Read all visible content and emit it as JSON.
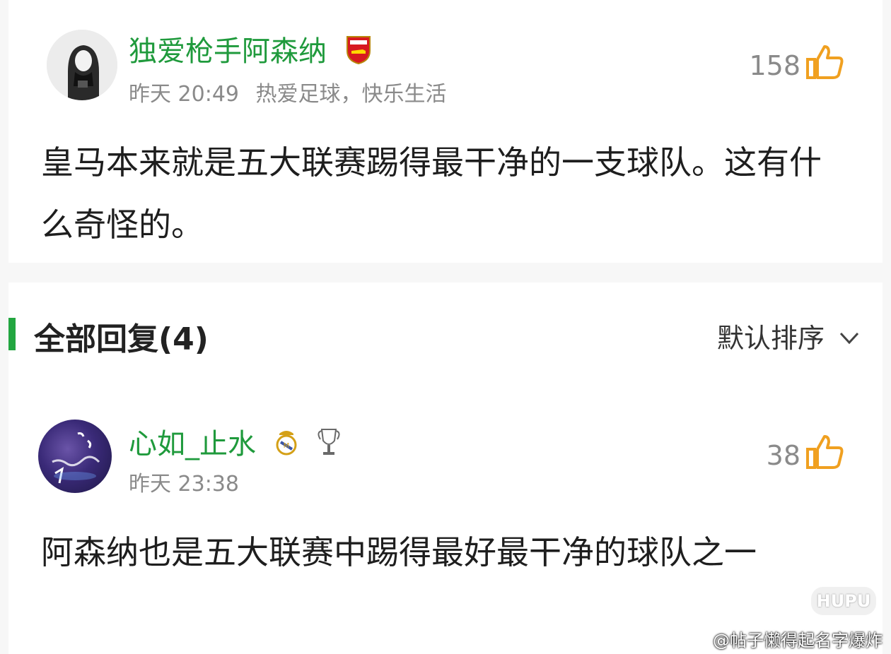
{
  "top_comment": {
    "username": "独爱枪手阿森纳",
    "time": "昨天 20:49",
    "tagline": "热爱足球，快乐生活",
    "likes": "158",
    "content": "皇马本来就是五大联赛踢得最干净的一支球队。这有什么奇怪的。",
    "badge_icon": "arsenal-crest-icon"
  },
  "replies_header": {
    "title": "全部回复(4)",
    "sort_label": "默认排序"
  },
  "reply": {
    "username": "心如_止水",
    "time": "昨天 23:38",
    "likes": "38",
    "content": "阿森纳也是五大联赛中踢得最好最干净的球队之一",
    "badges": [
      "real-madrid-crest-icon",
      "champions-trophy-icon"
    ]
  },
  "watermark": {
    "logo_text": "HUPU",
    "text": "@帖子懒得起名字爆炸"
  },
  "colors": {
    "username_green": "#1f9a3c",
    "accent_green": "#22a640",
    "meta_gray": "#8a8a8a",
    "like_orange": "#f0a020"
  }
}
